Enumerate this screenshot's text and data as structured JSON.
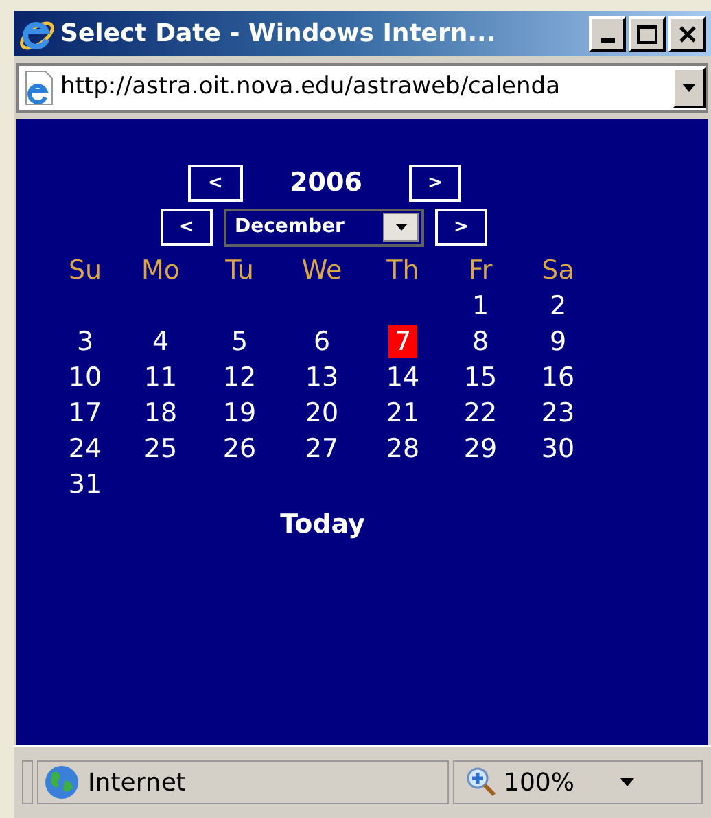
{
  "window": {
    "title": "Select Date - Windows Intern..."
  },
  "address_bar": {
    "value": "http://astra.oit.nova.edu/astraweb/calenda"
  },
  "calendar": {
    "year": "2006",
    "prev_year": "<",
    "next_year": ">",
    "prev_month": "<",
    "next_month": ">",
    "month": "December",
    "weekdays": [
      "Su",
      "Mo",
      "Tu",
      "We",
      "Th",
      "Fr",
      "Sa"
    ],
    "weeks": [
      [
        {
          "day": "1",
          "selected": false
        },
        {
          "day": "2",
          "selected": false
        }
      ],
      [
        {
          "day": "3",
          "selected": false
        },
        {
          "day": "4",
          "selected": false
        },
        {
          "day": "5",
          "selected": false
        },
        {
          "day": "6",
          "selected": false
        },
        {
          "day": "7",
          "selected": true
        },
        {
          "day": "8",
          "selected": false
        },
        {
          "day": "9",
          "selected": false
        }
      ],
      [
        {
          "day": "10",
          "selected": false
        },
        {
          "day": "11",
          "selected": false
        },
        {
          "day": "12",
          "selected": false
        },
        {
          "day": "13",
          "selected": false
        },
        {
          "day": "14",
          "selected": false
        },
        {
          "day": "15",
          "selected": false
        },
        {
          "day": "16",
          "selected": false
        }
      ],
      [
        {
          "day": "17",
          "selected": false
        },
        {
          "day": "18",
          "selected": false
        },
        {
          "day": "19",
          "selected": false
        },
        {
          "day": "20",
          "selected": false
        },
        {
          "day": "21",
          "selected": false
        },
        {
          "day": "22",
          "selected": false
        },
        {
          "day": "23",
          "selected": false
        }
      ],
      [
        {
          "day": "24",
          "selected": false
        },
        {
          "day": "25",
          "selected": false
        },
        {
          "day": "26",
          "selected": false
        },
        {
          "day": "27",
          "selected": false
        },
        {
          "day": "28",
          "selected": false
        },
        {
          "day": "29",
          "selected": false
        },
        {
          "day": "30",
          "selected": false
        }
      ],
      [
        {
          "day": "31",
          "selected": false
        }
      ]
    ],
    "today_link": "Today"
  },
  "status_bar": {
    "zone": "Internet",
    "zoom": "100%"
  }
}
